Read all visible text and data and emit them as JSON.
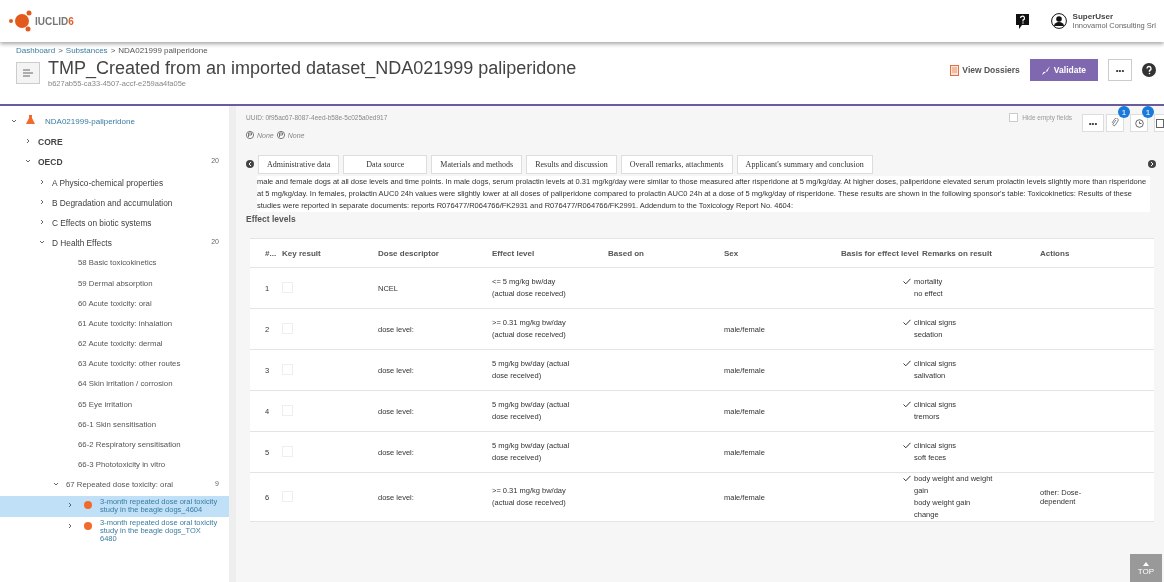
{
  "header": {
    "logo": "IUCLID",
    "logo_version": "6",
    "user": {
      "name": "SuperUser",
      "company": "Innovamol Consulting Srl"
    }
  },
  "breadcrumb": [
    "Dashboard",
    "Substances",
    "NDA021999 paliperidone"
  ],
  "breadcrumb_separators": [
    ">",
    ">"
  ],
  "title": "TMP_Created from an imported dataset_NDA021999 paliperidone",
  "subtitle": "b627ab55-ca33-4507-accf-e259aa4fa05e",
  "actions": {
    "view_dossiers": "View Dossiers",
    "validate": "Validate",
    "more": "•••"
  },
  "sidebar": {
    "tree": [
      {
        "label": "NDA021999-paliperidone",
        "kind": "substance",
        "expanded": true,
        "selected": false,
        "children": [
          {
            "label": "CORE",
            "kind": "section",
            "expanded": false,
            "selected": false
          },
          {
            "label": "OECD",
            "kind": "section",
            "count": "20",
            "expanded": true,
            "selected": false,
            "children": [
              {
                "label": "A Physico-chemical properties",
                "kind": "group",
                "expanded": false,
                "selected": false
              },
              {
                "label": "B Degradation and accumulation",
                "kind": "group",
                "expanded": false,
                "selected": false
              },
              {
                "label": "C Effects on biotic systems",
                "kind": "group",
                "expanded": false,
                "selected": false
              },
              {
                "label": "D Health Effects",
                "kind": "group",
                "count": "20",
                "expanded": true,
                "selected": false,
                "children": [
                  {
                    "label": "58 Basic toxicokinetics",
                    "kind": "endpoint",
                    "selected": false
                  },
                  {
                    "label": "59 Dermal absorption",
                    "kind": "endpoint",
                    "selected": false
                  },
                  {
                    "label": "60 Acute toxicity: oral",
                    "kind": "endpoint",
                    "selected": false
                  },
                  {
                    "label": "61 Acute toxicity: inhalation",
                    "kind": "endpoint",
                    "selected": false
                  },
                  {
                    "label": "62 Acute toxicity: dermal",
                    "kind": "endpoint",
                    "selected": false
                  },
                  {
                    "label": "63 Acute toxicity: other routes",
                    "kind": "endpoint",
                    "selected": false
                  },
                  {
                    "label": "64 Skin irritation / corrosion",
                    "kind": "endpoint",
                    "selected": false
                  },
                  {
                    "label": "65 Eye irritation",
                    "kind": "endpoint",
                    "selected": false
                  },
                  {
                    "label": "66-1 Skin sensitisation",
                    "kind": "endpoint",
                    "selected": false
                  },
                  {
                    "label": "66-2 Respiratory sensitisation",
                    "kind": "endpoint",
                    "selected": false
                  },
                  {
                    "label": "66-3 Phototoxicity in vitro",
                    "kind": "endpoint",
                    "selected": false
                  },
                  {
                    "label": "67 Repeated dose toxicity: oral",
                    "kind": "endpoint",
                    "count": "9",
                    "expanded": true,
                    "selected": false,
                    "children": [
                      {
                        "label": "3-month repeated dose oral toxicity study in the beagle dogs_4604",
                        "kind": "record",
                        "expanded": false,
                        "selected": true
                      },
                      {
                        "label": "3-month repeated dose oral toxicity study in the beagle dogs_TOX 6480",
                        "kind": "record",
                        "expanded": false,
                        "selected": false
                      }
                    ]
                  }
                ]
              }
            ]
          }
        ]
      }
    ]
  },
  "content": {
    "uuid": "UUID: 0f95ac67-8087-4eed-b58e-5c025a0ed917",
    "hide_empty": {
      "label": "Hide empty fields",
      "checked": false
    },
    "toolbar_badges": [
      "1",
      "1"
    ],
    "more": "•••",
    "flags": [
      "None",
      "None"
    ],
    "tabs": [
      {
        "label": "Administrative data",
        "selected": false
      },
      {
        "label": "Data source",
        "selected": false
      },
      {
        "label": "Materials and methods",
        "selected": false
      },
      {
        "label": "Results and discussion",
        "selected": false
      },
      {
        "label": "Overall remarks, attachments",
        "selected": false
      },
      {
        "label": "Applicant's summary and conclusion",
        "selected": false
      }
    ],
    "paragraph": "male and female dogs at all dose levels and time points. In male dogs, serum prolactin levels at 0.31 mg/kg/day were similar to those measured after risperidone at 5 mg/kg/day. At higher doses, paliperidone elevated serum prolactin levels slightly more than risperidone at 5 mg/kg/day. In females, prolactin AUC0 24h values were slightly lower at all doses of paliperidone compared to prolactin AUC0 24h at a dose of 5 mg/kg/day of risperidone. These results are shown in the following sponsor's table: Toxicokinetics: Results of these studies were reported in separate documents: reports R076477/R064766/FK2931 and R076477/R064766/FK2991. Addendum to the Toxicology Report No. 4604:",
    "section_title": "Effect levels",
    "table": {
      "columns": [
        "#...",
        "Key result",
        "Dose descriptor",
        "Effect level",
        "Based on",
        "Sex",
        "Basis for effect level",
        "Remarks on result",
        "Actions"
      ],
      "rows": [
        {
          "num": "1",
          "key_result": false,
          "dose_descriptor": "NCEL",
          "effect_level": [
            "<= 5  mg/kg bw/day",
            "(actual dose received)"
          ],
          "sex": "",
          "basis": [
            "mortality",
            "no effect"
          ],
          "remarks": ""
        },
        {
          "num": "2",
          "key_result": false,
          "dose_descriptor": "dose level:",
          "effect_level": [
            ">= 0.31  mg/kg bw/day",
            "(actual dose received)"
          ],
          "sex": "male/female",
          "basis": [
            "clinical signs",
            "sedation"
          ],
          "remarks": ""
        },
        {
          "num": "3",
          "key_result": false,
          "dose_descriptor": "dose level:",
          "effect_level": [
            "5  mg/kg bw/day (actual",
            "dose received)"
          ],
          "sex": "male/female",
          "basis": [
            "clinical signs",
            "salivation"
          ],
          "remarks": ""
        },
        {
          "num": "4",
          "key_result": false,
          "dose_descriptor": "dose level:",
          "effect_level": [
            "5  mg/kg bw/day (actual",
            "dose received)"
          ],
          "sex": "male/female",
          "basis": [
            "clinical signs",
            "tremors"
          ],
          "remarks": ""
        },
        {
          "num": "5",
          "key_result": false,
          "dose_descriptor": "dose level:",
          "effect_level": [
            "5  mg/kg bw/day (actual",
            "dose received)"
          ],
          "sex": "male/female",
          "basis": [
            "clinical signs",
            "soft feces"
          ],
          "remarks": ""
        },
        {
          "num": "6",
          "key_result": false,
          "dose_descriptor": "dose level:",
          "effect_level": [
            ">= 0.31  mg/kg bw/day",
            "(actual dose received)"
          ],
          "sex": "male/female",
          "basis": [
            "body weight and weight gain",
            "body weight gain change"
          ],
          "remarks": "other:  Dose-dependent"
        }
      ]
    },
    "top_button": "TOP"
  }
}
